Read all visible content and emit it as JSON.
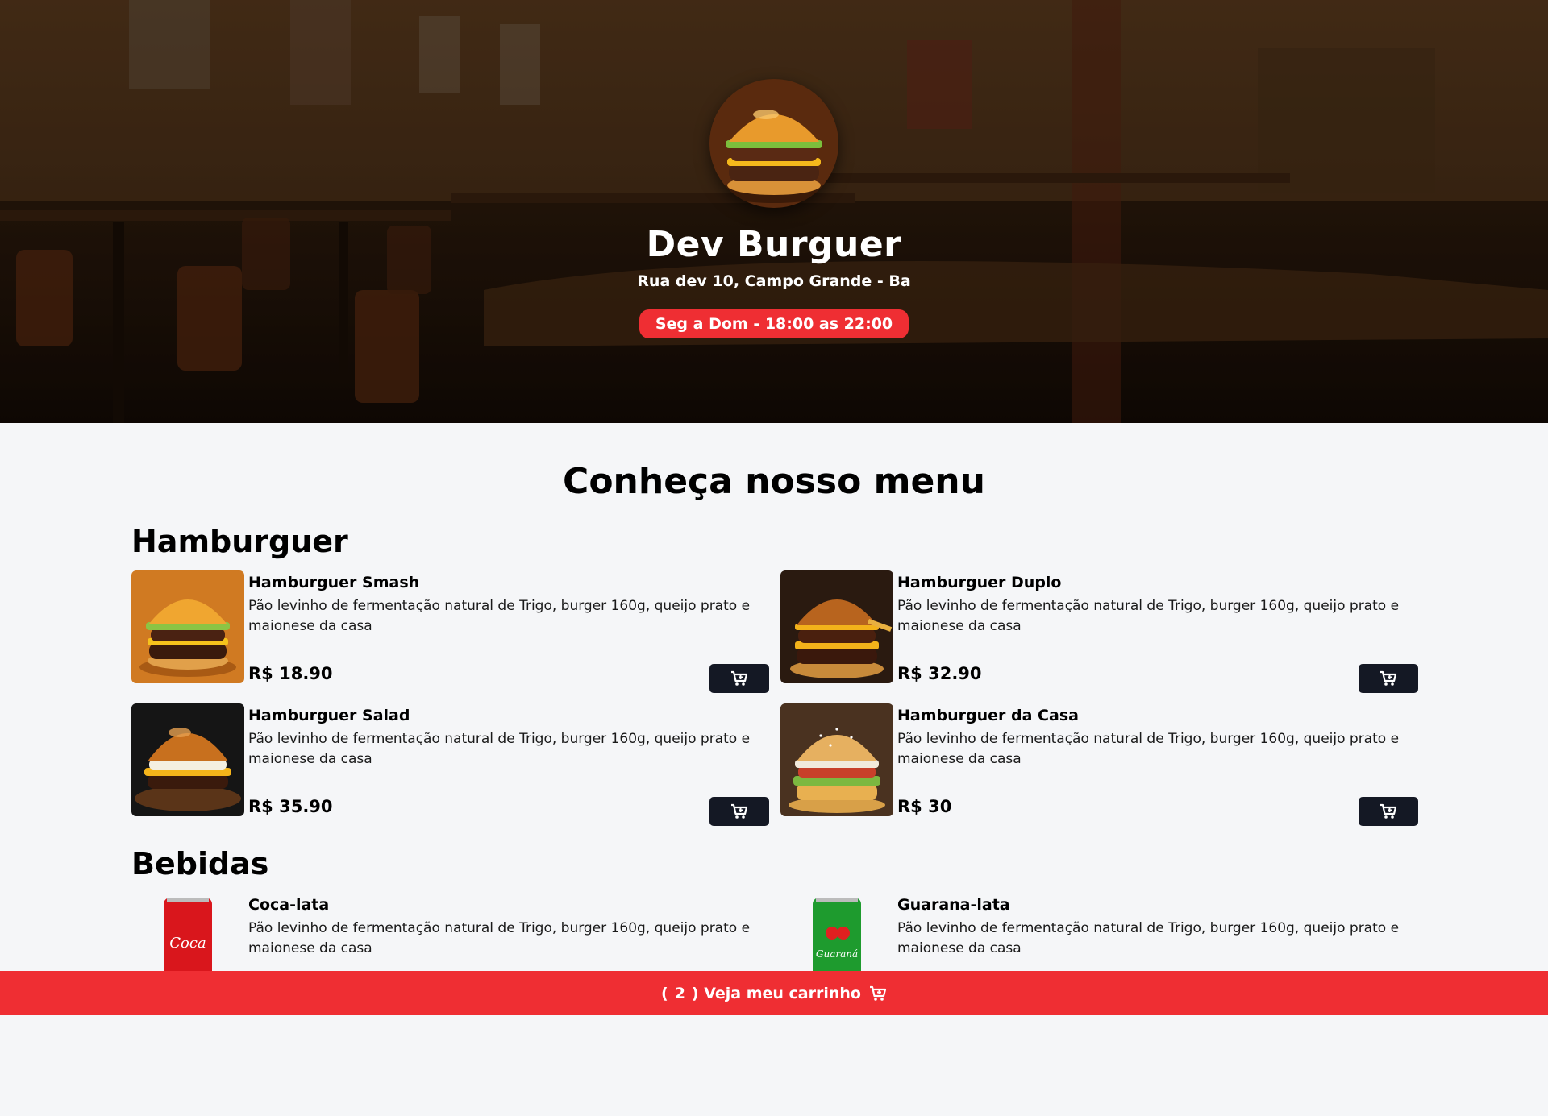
{
  "header": {
    "title": "Dev Burguer",
    "address": "Rua dev 10, Campo Grande - Ba",
    "hours": "Seg a Dom - 18:00 as 22:00",
    "hours_badge_color": "#ef2e33"
  },
  "menu": {
    "title": "Conheça nosso menu",
    "sections": {
      "burgers": {
        "title": "Hamburguer",
        "items": [
          {
            "name": "Hamburguer Smash",
            "description": "Pão levinho de fermentação natural de Trigo, burger 160g, queijo prato e maionese da casa",
            "price": "R$ 18.90",
            "icon": "burger-image"
          },
          {
            "name": "Hamburguer Duplo",
            "description": "Pão levinho de fermentação natural de Trigo, burger 160g, queijo prato e maionese da casa",
            "price": "R$ 32.90",
            "icon": "burger-image"
          },
          {
            "name": "Hamburguer Salad",
            "description": "Pão levinho de fermentação natural de Trigo, burger 160g, queijo prato e maionese da casa",
            "price": "R$ 35.90",
            "icon": "burger-image"
          },
          {
            "name": "Hamburguer da Casa",
            "description": "Pão levinho de fermentação natural de Trigo, burger 160g, queijo prato e maionese da casa",
            "price": "R$ 30",
            "icon": "burger-image"
          }
        ]
      },
      "drinks": {
        "title": "Bebidas",
        "items": [
          {
            "name": "Coca-lata",
            "description": "Pão levinho de fermentação natural de Trigo, burger 160g, queijo prato e maionese da casa",
            "icon": "soda-can-image"
          },
          {
            "name": "Guarana-lata",
            "description": "Pão levinho de fermentação natural de Trigo, burger 160g, queijo prato e maionese da casa",
            "icon": "soda-can-image"
          }
        ]
      }
    },
    "add_button_icon": "add-to-cart-icon"
  },
  "cart_bar": {
    "open_paren": "(",
    "count": "2",
    "label": ") Veja meu carrinho",
    "icon": "shopping-cart-icon",
    "color": "#ef2e33"
  }
}
